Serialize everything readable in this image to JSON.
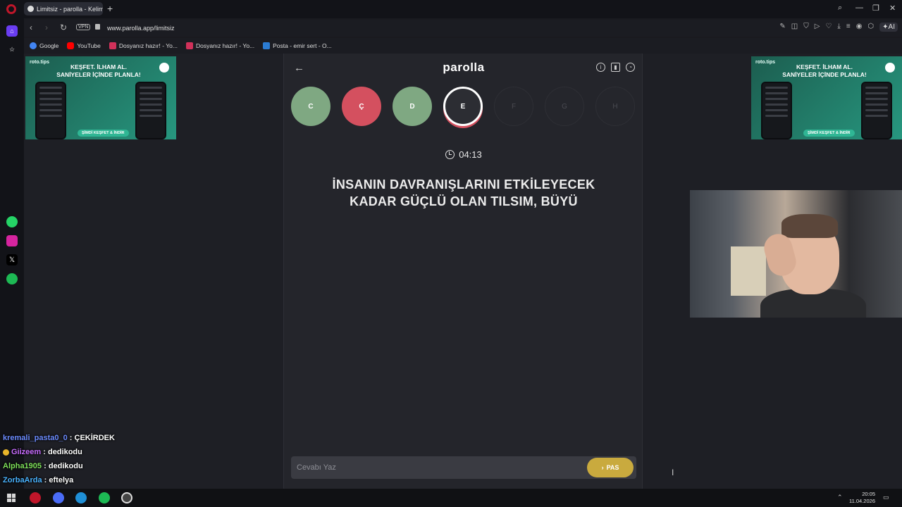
{
  "browser": {
    "tab_title": "Limitsiz - parolla - Kelime",
    "url": "www.parolla.app/limitsiz",
    "vpn_label": "VPN",
    "ai_label": "AI",
    "bookmarks": [
      {
        "label": "Google",
        "color": "#4285f4"
      },
      {
        "label": "YouTube",
        "color": "#ff0000"
      },
      {
        "label": "Dosyanız hazır! - Yo...",
        "color": "#d0315a"
      },
      {
        "label": "Dosyanız hazır! - Yo...",
        "color": "#d0315a"
      },
      {
        "label": "Posta - emir sert - O...",
        "color": "#2b7cd3"
      }
    ]
  },
  "ads": {
    "brand": "roto.tips",
    "headline": "KEŞFET. İLHAM AL. SANİYELER İÇİNDE PLANLA!",
    "cta": "ŞİMDİ KEŞFET & İNDİR"
  },
  "game": {
    "logo": "parolla",
    "letters": [
      {
        "char": "C",
        "state": "correct"
      },
      {
        "char": "Ç",
        "state": "wrong"
      },
      {
        "char": "D",
        "state": "correct"
      },
      {
        "char": "E",
        "state": "current"
      },
      {
        "char": "F",
        "state": "pending"
      },
      {
        "char": "G",
        "state": "pending"
      },
      {
        "char": "H",
        "state": "pending"
      }
    ],
    "timer": "04:13",
    "question": "İNSANIN DAVRANIŞLARINI ETKİLEYECEK KADAR GÜÇLÜ OLAN TILSIM, BÜYÜ",
    "answer_placeholder": "Cevabı Yaz",
    "pass_label": "PAS"
  },
  "chat": [
    {
      "user": "kremali_pasta0_0",
      "message": "ÇEKİRDEK"
    },
    {
      "user": "Giizeem",
      "message": "dedikodu"
    },
    {
      "user": "Alpha1905",
      "message": "dedikodu"
    },
    {
      "user": "ZorbaArda",
      "message": "eftelya"
    }
  ],
  "taskbar": {
    "time": "20:05",
    "date": "11.04.2026"
  },
  "colors": {
    "correct": "#7fa882",
    "wrong": "#d4505f",
    "pass_button": "#c9aa3e"
  }
}
